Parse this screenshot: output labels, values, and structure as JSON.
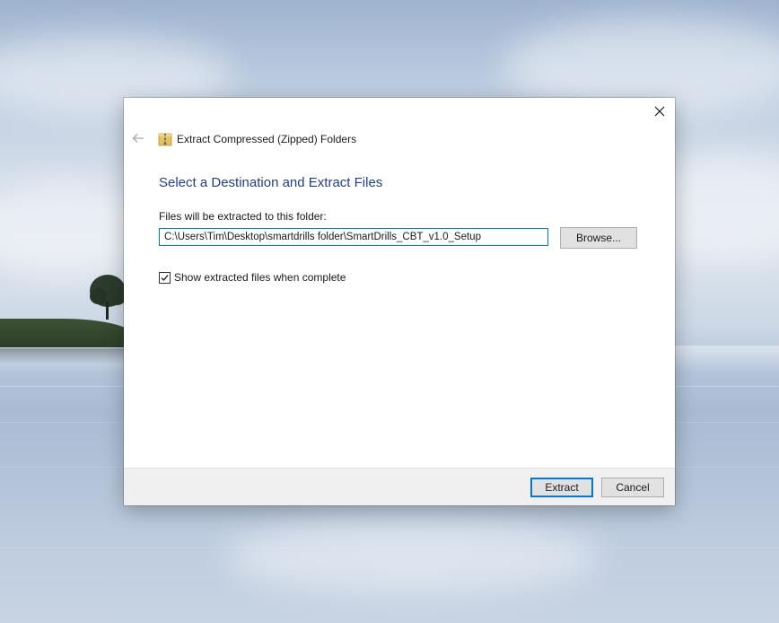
{
  "window": {
    "title": "Extract Compressed (Zipped) Folders",
    "icon": "zip-folder-icon"
  },
  "main": {
    "heading": "Select a Destination and Extract Files",
    "path_label": "Files will be extracted to this folder:",
    "path_value": "C:\\Users\\Tim\\Desktop\\smartdrills folder\\SmartDrills_CBT_v1.0_Setup",
    "browse_label": "Browse...",
    "show_files_label": "Show extracted files when complete",
    "show_files_checked": true
  },
  "footer": {
    "extract_label": "Extract",
    "cancel_label": "Cancel"
  },
  "colors": {
    "accent": "#0078d7",
    "heading": "#1e3f8f",
    "button_bg": "#e1e1e1",
    "footer_bg": "#f0f0f0"
  }
}
